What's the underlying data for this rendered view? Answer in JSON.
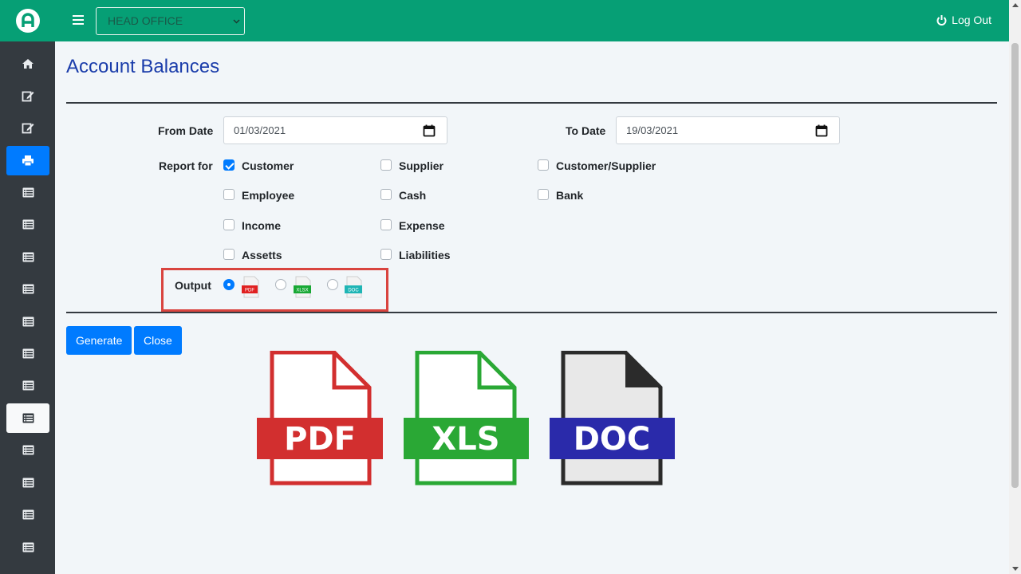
{
  "topbar": {
    "branch": "HEAD OFFICE",
    "logout_label": "Log Out"
  },
  "sidebar": {
    "items": [
      {
        "icon": "home-icon",
        "state": "normal"
      },
      {
        "icon": "edit-icon",
        "state": "normal"
      },
      {
        "icon": "edit-icon",
        "state": "normal"
      },
      {
        "icon": "print-icon",
        "state": "active"
      },
      {
        "icon": "list-icon",
        "state": "normal"
      },
      {
        "icon": "list-icon",
        "state": "normal"
      },
      {
        "icon": "list-icon",
        "state": "normal"
      },
      {
        "icon": "list-icon",
        "state": "normal"
      },
      {
        "icon": "list-icon",
        "state": "normal"
      },
      {
        "icon": "list-icon",
        "state": "normal"
      },
      {
        "icon": "list-icon",
        "state": "normal"
      },
      {
        "icon": "list-icon",
        "state": "selected"
      },
      {
        "icon": "list-icon",
        "state": "normal"
      },
      {
        "icon": "list-icon",
        "state": "normal"
      },
      {
        "icon": "list-icon",
        "state": "normal"
      },
      {
        "icon": "list-icon",
        "state": "normal"
      }
    ]
  },
  "page": {
    "title": "Account Balances"
  },
  "form": {
    "from_date_label": "From Date",
    "from_date_value": "01/03/2021",
    "to_date_label": "To Date",
    "to_date_value": "19/03/2021",
    "report_for_label": "Report for",
    "options": [
      {
        "label": "Customer",
        "checked": true
      },
      {
        "label": "Supplier",
        "checked": false
      },
      {
        "label": "Customer/Supplier",
        "checked": false
      },
      {
        "label": "Employee",
        "checked": false
      },
      {
        "label": "Cash",
        "checked": false
      },
      {
        "label": "Bank",
        "checked": false
      },
      {
        "label": "Income",
        "checked": false
      },
      {
        "label": "Expense",
        "checked": false
      },
      {
        "label": "Assetts",
        "checked": false
      },
      {
        "label": "Liabilities",
        "checked": false
      }
    ],
    "output_label": "Output",
    "output_formats": [
      {
        "label": "PDF",
        "color": "#e02020",
        "selected": true
      },
      {
        "label": "XLSX",
        "color": "#18a834",
        "selected": false
      },
      {
        "label": "DOC",
        "color": "#1fb5b5",
        "selected": false
      }
    ]
  },
  "buttons": {
    "generate": "Generate",
    "close": "Close"
  },
  "format_icons": [
    {
      "label": "PDF",
      "color": "#d22f2f"
    },
    {
      "label": "XLS",
      "color": "#2aa835"
    },
    {
      "label": "DOC",
      "color": "#2a2aaa"
    }
  ],
  "colors": {
    "brand": "#069f75",
    "primary": "#007bff",
    "sidebar": "#343a40",
    "title": "#1a3caa",
    "highlight": "#d9443f"
  }
}
